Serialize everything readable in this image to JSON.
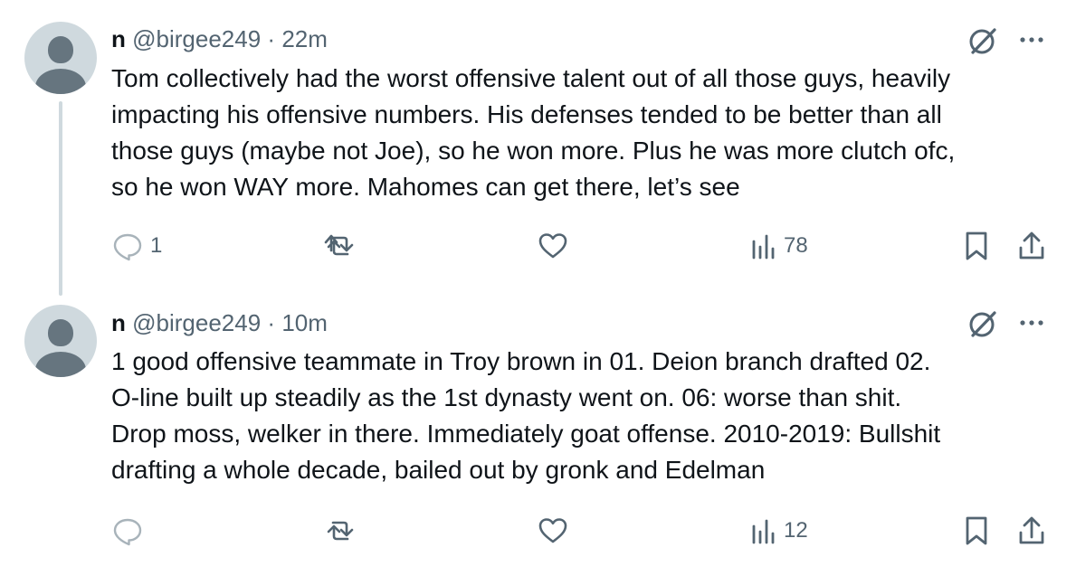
{
  "tweets": [
    {
      "author_name": "n",
      "handle": "@birgee249",
      "separator": "·",
      "time": "22m",
      "text": "Tom collectively had the worst offensive talent out of all those guys, heavily\nimpacting his offensive numbers. His defenses tended to be better than all\nthose guys (maybe not Joe), so he won more. Plus he was more clutch ofc,\nso he won WAY more. Mahomes can get there, let’s see",
      "reply_count": "1",
      "retweet_count": "",
      "like_count": "",
      "view_count": "78"
    },
    {
      "author_name": "n",
      "handle": "@birgee249",
      "separator": "·",
      "time": "10m",
      "text": "1 good offensive teammate in Troy brown in 01. Deion  branch drafted 02.\nO-line built up steadily as the 1st dynasty went on. 06: worse than shit.\nDrop moss, welker in there. Immediately goat offense. 2010-2019: Bullshit\ndrafting a whole decade, bailed out by gronk and Edelman",
      "reply_count": "",
      "retweet_count": "",
      "like_count": "",
      "view_count": "12"
    }
  ],
  "icons": {
    "avatar": "default-profile-avatar",
    "grok": "grok-icon",
    "more": "more-icon",
    "reply": "reply-icon",
    "retweet": "retweet-icon",
    "like": "heart-icon",
    "views": "views-icon",
    "bookmark": "bookmark-icon",
    "share": "share-icon"
  },
  "colors": {
    "text": "#0f1419",
    "secondary": "#536471",
    "thread_line": "#cfd9de",
    "avatar_bg": "#cfd9de",
    "avatar_fg": "#66757f"
  }
}
